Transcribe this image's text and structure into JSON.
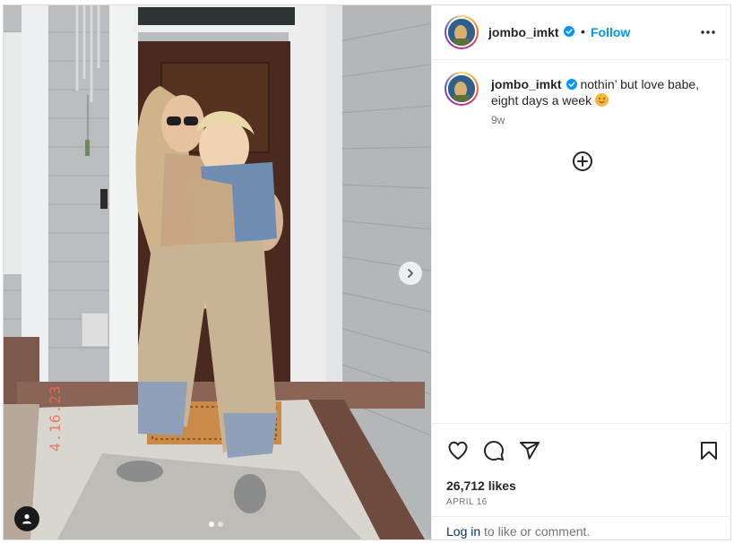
{
  "post": {
    "author": {
      "username": "jombo_imkt",
      "verified": true,
      "avatar": "profile-photo"
    },
    "header": {
      "separator": "•",
      "follow_label": "Follow",
      "more_icon": "more-horizontal-icon"
    },
    "caption": {
      "username": "jombo_imkt",
      "text": "nothin’ but love babe, eight days a week",
      "emoji": "smiling-face-emoji",
      "time_ago": "9w"
    },
    "load_more_icon": "plus-circle-icon",
    "media": {
      "photo_stamp": "4.16.23",
      "carousel": {
        "current": 1,
        "total": 2
      },
      "next_icon": "chevron-right-icon",
      "tag_icon": "user-tag-icon"
    },
    "actions": {
      "like_icon": "heart-icon",
      "comment_icon": "comment-icon",
      "share_icon": "paper-plane-icon",
      "save_icon": "bookmark-icon"
    },
    "likes": "26,712 likes",
    "date": "APRIL 16",
    "login": {
      "link": "Log in",
      "rest": " to like or comment."
    }
  },
  "colors": {
    "follow_blue": "#0095f6",
    "link_navy": "#00376b",
    "verified_blue": "#0095f6",
    "secondary_text": "#737373"
  }
}
